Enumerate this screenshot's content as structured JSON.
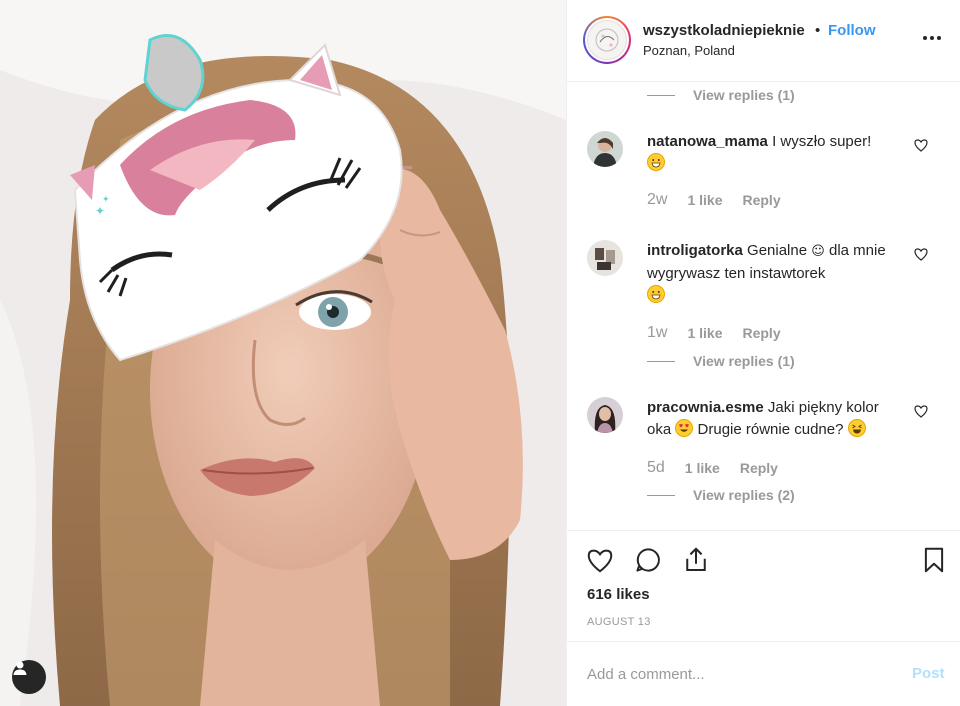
{
  "post": {
    "username": "wszystkoladniepieknie",
    "separator": "•",
    "follow_label": "Follow",
    "location": "Poznan, Poland",
    "likes": "616 likes",
    "date": "AUGUST 13"
  },
  "comments": [
    {
      "view_replies": "View replies (1)"
    },
    {
      "username": "natanowa_mama",
      "text": "I wyszło super!",
      "emoji": "grinning-face",
      "time": "2w",
      "likes": "1 like",
      "reply": "Reply"
    },
    {
      "username": "introligatorka",
      "text_a": "Genialne",
      "text_b": "dla mnie wygrywasz ten instawtorek",
      "emoji": "grinning-face",
      "time": "1w",
      "likes": "1 like",
      "reply": "Reply",
      "view_replies": "View replies (1)"
    },
    {
      "username": "pracownia.esme",
      "text_a": "Jaki piękny kolor oka",
      "text_b": "Drugie równie cudne?",
      "emoji_a": "heart-eyes",
      "emoji_b": "laughing-face",
      "time": "5d",
      "likes": "1 like",
      "reply": "Reply",
      "view_replies": "View replies (2)"
    }
  ],
  "composer": {
    "placeholder": "Add a comment...",
    "post_label": "Post"
  },
  "colors": {
    "link_blue": "#3897f0",
    "muted_gray": "#999999",
    "post_disabled": "#b2dffc",
    "text": "#262626"
  }
}
